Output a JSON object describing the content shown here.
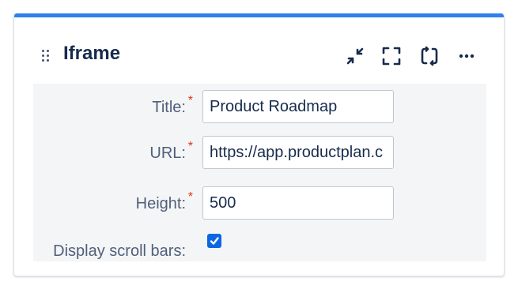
{
  "macro": {
    "title": "Iframe",
    "icons": {
      "drag": "drag-handle-icon",
      "collapse": "collapse-icon",
      "fullscreen": "fullscreen-icon",
      "refresh": "refresh-icon",
      "more": "more-icon"
    },
    "accent_color": "#2f80ed"
  },
  "form": {
    "required_marker": "*",
    "title_label": "Title:",
    "title_value": "Product Roadmap",
    "url_label": "URL:",
    "url_value": "https://app.productplan.c",
    "height_label": "Height:",
    "height_value": "500",
    "scroll_label": "Display scroll bars:",
    "scroll_checked": true
  }
}
